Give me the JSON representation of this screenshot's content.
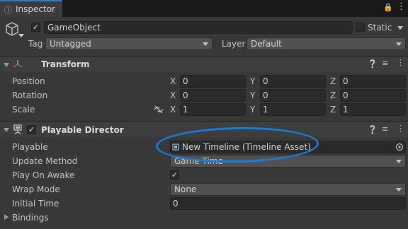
{
  "tab": {
    "title": "Inspector",
    "icons": [
      "info-icon",
      "lock-icon",
      "menu-icon"
    ]
  },
  "header": {
    "name": "GameObject",
    "static_label": "Static",
    "tag_label": "Tag",
    "tag_value": "Untagged",
    "layer_label": "Layer",
    "layer_value": "Default"
  },
  "transform": {
    "title": "Transform",
    "rows": [
      {
        "label": "Position",
        "x": "0",
        "y": "0",
        "z": "0"
      },
      {
        "label": "Rotation",
        "x": "0",
        "y": "0",
        "z": "0"
      },
      {
        "label": "Scale",
        "x": "1",
        "y": "1",
        "z": "1"
      }
    ],
    "axes": {
      "x": "X",
      "y": "Y",
      "z": "Z"
    }
  },
  "director": {
    "title": "Playable Director",
    "playable_label": "Playable",
    "playable_value": "New Timeline (Timeline Asset)",
    "update_label": "Update Method",
    "update_value": "Game Time",
    "play_on_awake_label": "Play On Awake",
    "wrap_label": "Wrap Mode",
    "wrap_value": "None",
    "initial_time_label": "Initial Time",
    "initial_time_value": "0",
    "bindings_label": "Bindings"
  },
  "colors": {
    "annotation": "#1c7ad6",
    "accent": "#3a79bb"
  }
}
